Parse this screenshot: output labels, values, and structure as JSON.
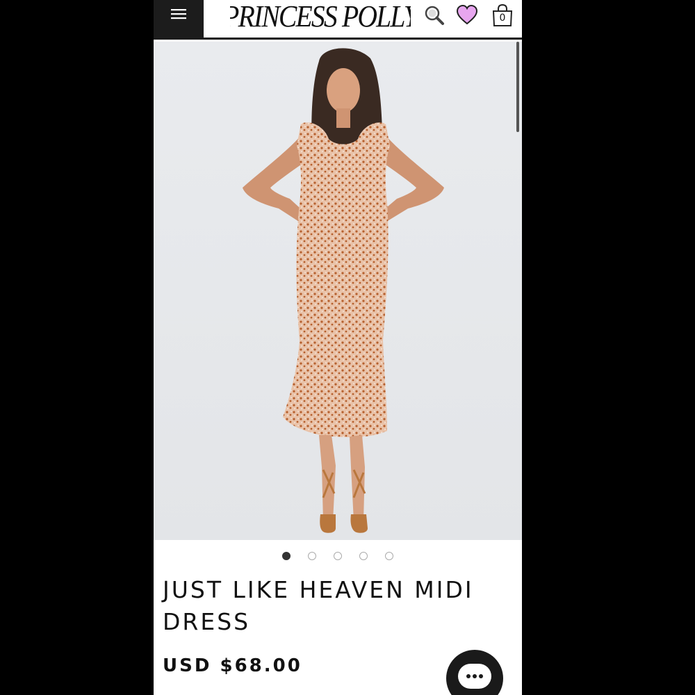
{
  "header": {
    "menu_icon": "hamburger-icon",
    "logo_text": "PRINCESS POLLY",
    "search_icon": "search-icon",
    "wishlist_icon": "heart-icon",
    "wishlist_color": "#c44fd6",
    "bag_icon": "shopping-bag-icon",
    "bag_count": "0"
  },
  "gallery": {
    "image_count": 5,
    "active_index": 0
  },
  "product": {
    "title": "JUST LIKE HEAVEN MIDI DRESS",
    "price": "USD $68.00"
  },
  "chat": {
    "icon": "chat-bubble-icon"
  }
}
